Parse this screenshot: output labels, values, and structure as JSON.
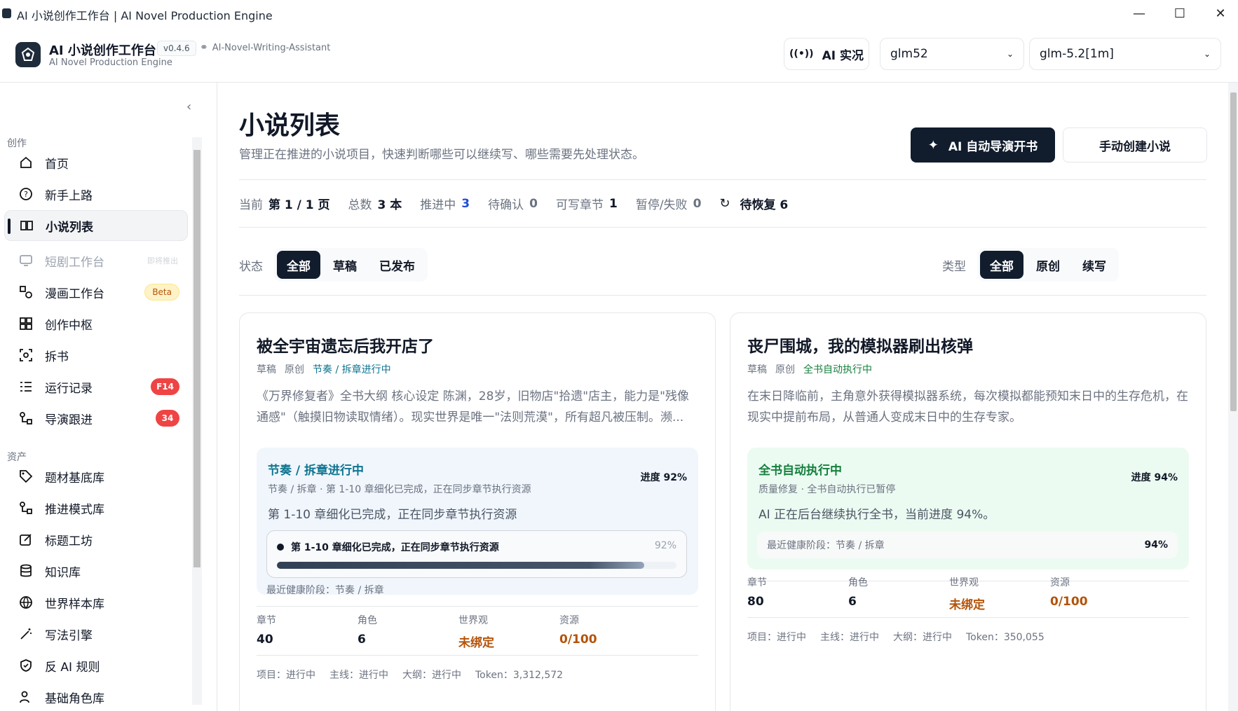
{
  "window": {
    "title": "AI 小说创作工作台 | AI Novel Production Engine"
  },
  "header": {
    "app_title": "AI 小说创作工作台",
    "app_subtitle": "AI Novel Production Engine",
    "version": "v0.4.6",
    "repo": "AI-Novel-Writing-Assistant",
    "ai_live_label": "AI 实况",
    "model_provider": "glm52",
    "model_name": "glm-5.2[1m]"
  },
  "sidebar": {
    "section_create": "创作",
    "section_assets": "资产",
    "items": [
      {
        "label": "首页",
        "icon": "home-icon"
      },
      {
        "label": "新手上路",
        "icon": "help-icon"
      },
      {
        "label": "小说列表",
        "icon": "book-icon",
        "active": true
      },
      {
        "label": "短剧工作台",
        "icon": "monitor-icon",
        "tag": "即将推出",
        "disabled": true
      },
      {
        "label": "漫画工作台",
        "icon": "shapes-icon",
        "badge": "Beta"
      },
      {
        "label": "创作中枢",
        "icon": "grid-icon"
      },
      {
        "label": "拆书",
        "icon": "scan-icon"
      },
      {
        "label": "运行记录",
        "icon": "list-icon",
        "badge": "F14"
      },
      {
        "label": "导演跟进",
        "icon": "route-icon",
        "badge": "34"
      }
    ],
    "asset_items": [
      {
        "label": "题材基底库",
        "icon": "tag-icon"
      },
      {
        "label": "推进模式库",
        "icon": "route-icon"
      },
      {
        "label": "标题工坊",
        "icon": "edit-icon"
      },
      {
        "label": "知识库",
        "icon": "database-icon"
      },
      {
        "label": "世界样本库",
        "icon": "globe-icon"
      },
      {
        "label": "写法引擎",
        "icon": "wand-icon"
      },
      {
        "label": "反 AI 规则",
        "icon": "shield-icon"
      },
      {
        "label": "基础角色库",
        "icon": "users-icon"
      }
    ]
  },
  "main": {
    "title": "小说列表",
    "description": "管理正在推进的小说项目，快速判断哪些可以继续写、哪些需要先处理状态。",
    "btn_ai": "AI 自动导演开书",
    "btn_manual": "手动创建小说",
    "stats": {
      "page_label": "当前",
      "page_value": "第 1 / 1 页",
      "total_label": "总数",
      "total_value": "3 本",
      "progress_label": "推进中",
      "progress_value": "3",
      "pending_label": "待确认",
      "pending_value": "0",
      "writable_label": "可写章节",
      "writable_value": "1",
      "paused_label": "暂停/失败",
      "paused_value": "0",
      "recover_label": "待恢复 6"
    },
    "filters": {
      "status_label": "状态",
      "status_options": [
        "全部",
        "草稿",
        "已发布"
      ],
      "type_label": "类型",
      "type_options": [
        "全部",
        "原创",
        "续写"
      ]
    },
    "cards": [
      {
        "title": "被全宇宙遗忘后我开店了",
        "state": "草稿",
        "kind": "原创",
        "phase": "节奏 / 拆章进行中",
        "description": "《万界修复者》全书大纲 核心设定 陈渊，28岁，旧物店\"拾遗\"店主，能力是\"残像通感\"（触摸旧物读取情绪）。现实世界是唯一\"法则荒漠\"，所有超凡被压制。濒...",
        "box_title": "节奏 / 拆章进行中",
        "box_sub": "节奏 / 拆章 · 第 1-10 章细化已完成，正在同步章节执行资源",
        "box_progress": "进度 92%",
        "box_text": "第 1-10 章细化已完成，正在同步章节执行资源",
        "pill_text": "第 1-10 章细化已完成，正在同步章节执行资源",
        "pill_pct": "92%",
        "progress": 0.92,
        "health": "最近健康阶段：节奏 / 拆章",
        "metrics": [
          {
            "label": "章节",
            "value": "40"
          },
          {
            "label": "角色",
            "value": "6"
          },
          {
            "label": "世界观",
            "value": "未绑定"
          },
          {
            "label": "资源",
            "value": "0/100"
          }
        ],
        "footer": [
          "项目：进行中",
          "主线：进行中",
          "大纲：进行中",
          "Token：3,312,572"
        ]
      },
      {
        "title": "丧尸围城，我的模拟器刷出核弹",
        "state": "草稿",
        "kind": "原创",
        "phase": "全书自动执行中",
        "description": "在末日降临前，主角意外获得模拟器系统，每次模拟都能预知末日中的生存危机，在现实中提前布局，从普通人变成末日中的生存专家。",
        "box_title": "全书自动执行中",
        "box_sub": "质量修复 · 全书自动执行已暂停",
        "box_progress": "进度 94%",
        "box_text": "AI 正在后台继续执行全书，当前进度 94%。",
        "health_label": "最近健康阶段：节奏 / 拆章",
        "health_pct": "94%",
        "metrics": [
          {
            "label": "章节",
            "value": "80"
          },
          {
            "label": "角色",
            "value": "6"
          },
          {
            "label": "世界观",
            "value": "未绑定"
          },
          {
            "label": "资源",
            "value": "0/100"
          }
        ],
        "footer": [
          "项目：进行中",
          "主线：进行中",
          "大纲：进行中",
          "Token：350,055"
        ]
      }
    ]
  },
  "colors": {
    "accent_dark": "#111c2d",
    "phase_blue": "#0e7490",
    "phase_green": "#15803d",
    "warn": "#b45309",
    "badge_red": "#ef4444"
  }
}
